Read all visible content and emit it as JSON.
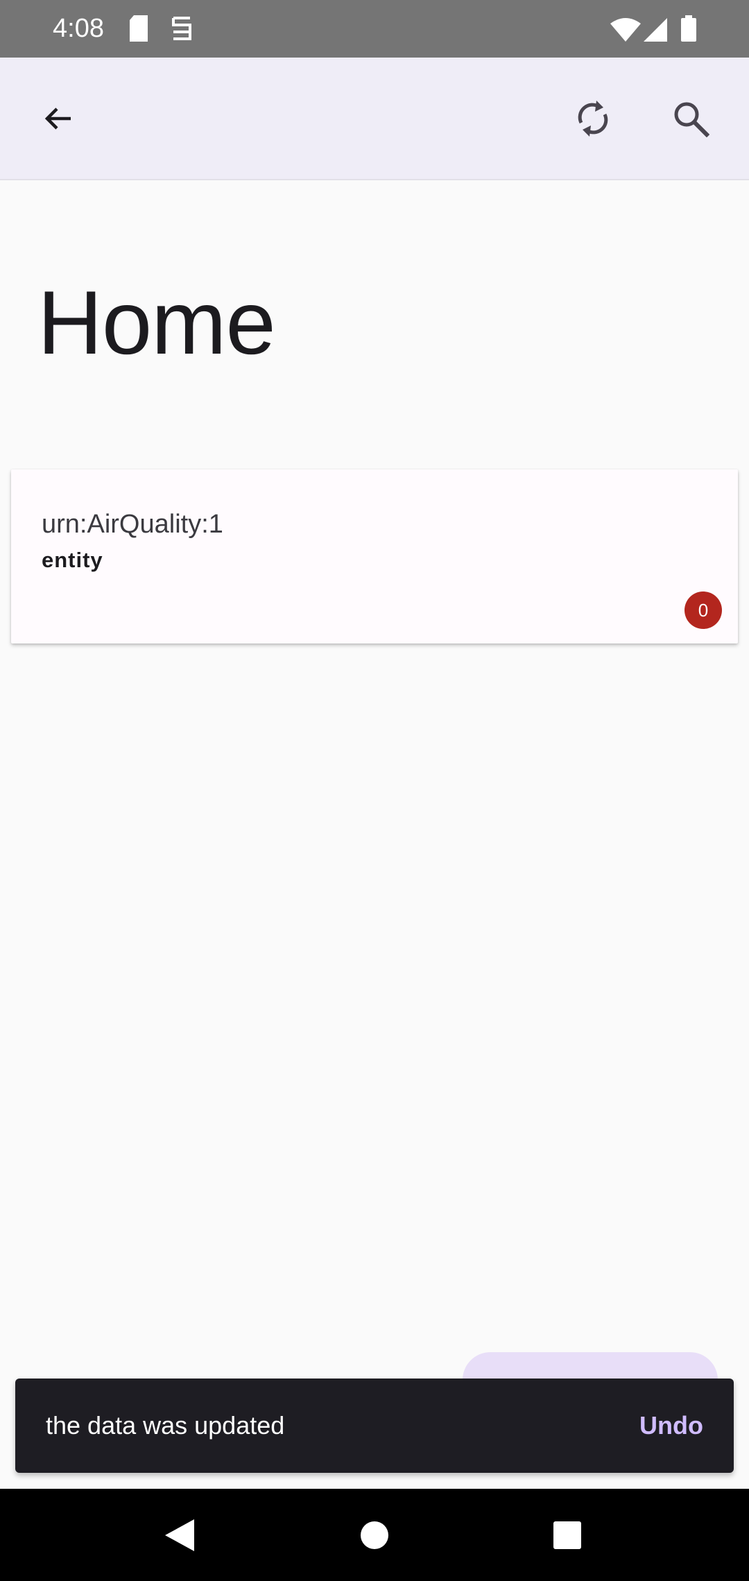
{
  "status_bar": {
    "time": "4:08",
    "icons": [
      "sd-card-icon",
      "screen-record-icon",
      "wifi-icon",
      "signal-icon",
      "battery-icon"
    ]
  },
  "app_bar": {
    "back_icon": "arrow-back-icon",
    "sync_icon": "sync-icon",
    "search_icon": "search-icon"
  },
  "page": {
    "title": "Home"
  },
  "entity_card": {
    "title": "urn:AirQuality:1",
    "subtitle": "entity",
    "badge_count": "0",
    "badge_color": "#b3261e"
  },
  "snackbar": {
    "message": "the data was updated",
    "action": "Undo",
    "action_color": "#d0bcff"
  },
  "nav_bar": {
    "icons": [
      "nav-back-icon",
      "nav-home-icon",
      "nav-recents-icon"
    ]
  }
}
